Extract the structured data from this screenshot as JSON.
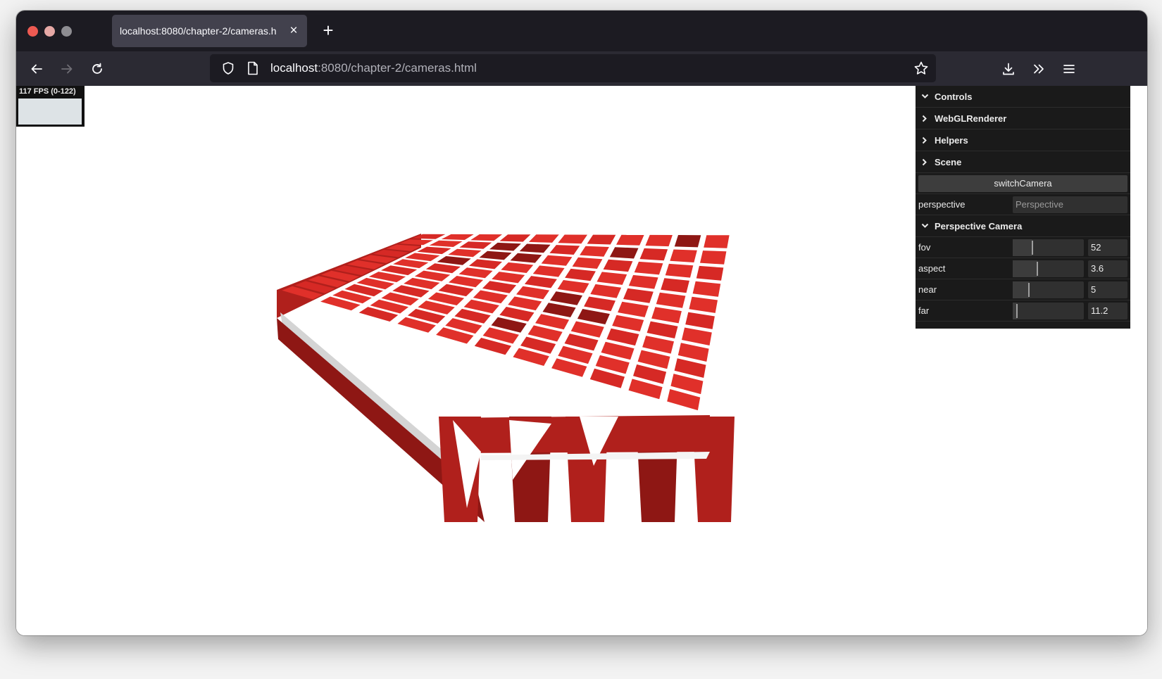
{
  "browser": {
    "tab_title": "localhost:8080/chapter-2/cameras.h",
    "tab_close": "×",
    "new_tab": "+",
    "url_host": "localhost",
    "url_rest": ":8080/chapter-2/cameras.html",
    "icons": [
      "back-icon",
      "forward-icon",
      "reload-icon",
      "shield-icon",
      "page-icon",
      "star-icon",
      "download-icon",
      "overflow-icon",
      "menu-icon"
    ]
  },
  "stats": {
    "text": "117 FPS (0-122)"
  },
  "gui": {
    "folders": {
      "controls": "Controls",
      "webgl": "WebGLRenderer",
      "helpers": "Helpers",
      "scene": "Scene",
      "perspective_camera": "Perspective Camera"
    },
    "switch_camera": "switchCamera",
    "perspective_label": "perspective",
    "perspective_value": "Perspective",
    "params": [
      {
        "label": "fov",
        "value": "52",
        "level": 0.28
      },
      {
        "label": "aspect",
        "value": "3.6",
        "level": 0.35
      },
      {
        "label": "near",
        "value": "5",
        "level": 0.23
      },
      {
        "label": "far",
        "value": "11.2",
        "level": 0.06
      }
    ]
  },
  "colors": {
    "cube_top": "#e0302a",
    "cube_side": "#b0201c",
    "cube_dark": "#8e1714",
    "plane": "#d4d4d4"
  }
}
